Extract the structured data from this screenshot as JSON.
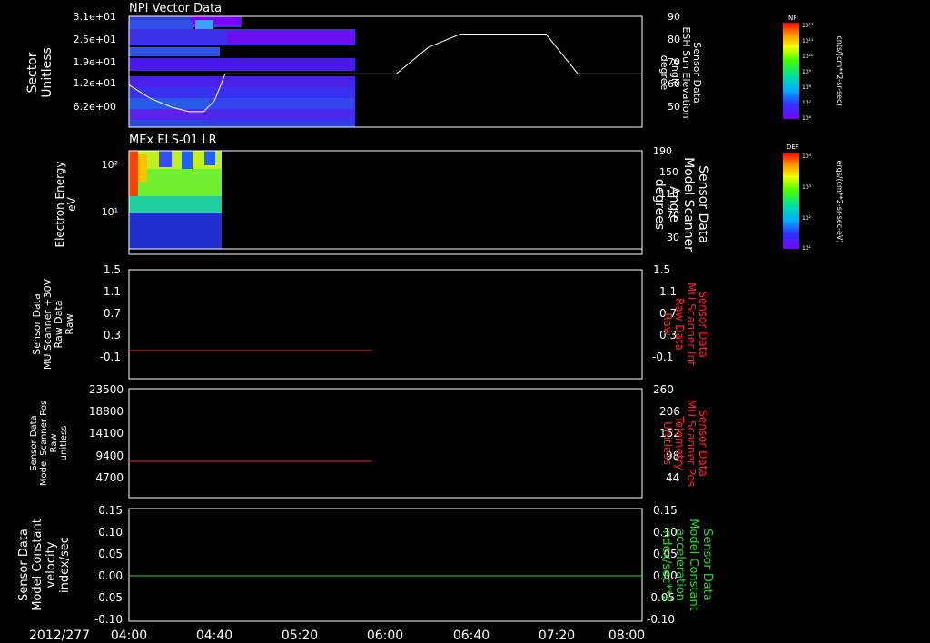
{
  "date_label": "2012/277",
  "time_axis": {
    "start": "04:00",
    "end": "08:00",
    "tick_labels": [
      "04:00",
      "04:40",
      "05:20",
      "06:00",
      "06:40",
      "07:20",
      "08:00"
    ]
  },
  "panels": [
    {
      "title": "NPI Vector Data",
      "left_label": [
        "Sector",
        "Unitless"
      ],
      "left_color": "#ffffff",
      "left_ticks": [
        "3.1e+01",
        "2.5e+01",
        "1.9e+01",
        "1.2e+01",
        "6.2e+00"
      ],
      "right_label": [
        "Sensor Data",
        "ESH Sun Elevation",
        "Angle",
        "degree"
      ],
      "right_color": "#ffffff",
      "right_ticks": [
        "90",
        "80",
        "70",
        "60",
        "50"
      ]
    },
    {
      "title": "MEx ELS-01 LR",
      "left_label": [
        "Electron Energy",
        "eV"
      ],
      "left_color": "#ffffff",
      "left_ticks": [
        "10²",
        "10¹"
      ],
      "right_label": [
        "Sensor Data",
        "Model Scanner",
        "Angle",
        "degrees"
      ],
      "right_color": "#ffffff",
      "right_ticks": [
        "190",
        "150",
        "110",
        "70",
        "30"
      ]
    },
    {
      "title": "",
      "left_label": [
        "Sensor Data",
        "MU Scanner +30V",
        "Raw Data",
        "Raw"
      ],
      "left_color": "#ffffff",
      "left_ticks": [
        "1.5",
        "1.1",
        "0.7",
        "0.3",
        "-0.1"
      ],
      "right_label": [
        "Sensor Data",
        "MU Scanner Int",
        "Raw Data",
        "Raw"
      ],
      "right_color": "#ff2020",
      "right_ticks": [
        "1.5",
        "1.1",
        "0.7",
        "0.3",
        "-0.1"
      ]
    },
    {
      "title": "",
      "left_label": [
        "Sensor Data",
        "Model Scanner Pos",
        "Raw",
        "unitless"
      ],
      "left_color": "#ffffff",
      "left_ticks": [
        "23500",
        "18800",
        "14100",
        "9400",
        "4700"
      ],
      "right_label": [
        "Sensor Data",
        "MU Scanner Pos",
        "Telemetry",
        "Unitless"
      ],
      "right_color": "#ff2020",
      "right_ticks": [
        "260",
        "206",
        "152",
        "98",
        "44"
      ]
    },
    {
      "title": "",
      "left_label": [
        "Sensor Data",
        "Model Constant",
        "velocity",
        "index/sec"
      ],
      "left_color": "#ffffff",
      "left_ticks": [
        "0.15",
        "0.10",
        "0.05",
        "0.00",
        "-0.05",
        "-0.10"
      ],
      "right_label": [
        "Sensor Data",
        "Model Constant",
        "acceleration",
        "index/sec**2"
      ],
      "right_color": "#22dd22",
      "right_ticks": [
        "0.15",
        "0.10",
        "0.05",
        "0.00",
        "-0.05",
        "-0.10"
      ]
    }
  ],
  "colorbars": [
    {
      "tag": "NF",
      "unit": "cnts/(cm**2-sr-sec)",
      "ticks": [
        "10¹²",
        "10¹¹",
        "10¹⁰",
        "10⁹",
        "10⁸",
        "10⁷",
        "10⁶"
      ]
    },
    {
      "tag": "DEF",
      "unit": "ergs/(cm**2-sr-sec-eV)",
      "ticks": [
        "10⁴",
        "10³",
        "10²",
        "10¹"
      ]
    }
  ],
  "chart_data": [
    {
      "type": "heatmap",
      "title": "NPI Vector Data",
      "ylabel": "Sector Unitless",
      "ylim": [
        0,
        34
      ],
      "x_range": [
        "04:00",
        "05:53"
      ],
      "yticks": [
        31,
        25,
        19,
        12,
        6.2
      ]
    },
    {
      "type": "line",
      "series": [
        {
          "name": "Sensor Data ESH Sun Elevation Angle",
          "x": [
            "04:00",
            "04:10",
            "04:20",
            "04:28",
            "04:35",
            "04:40",
            "04:45",
            "06:05",
            "06:20",
            "06:35",
            "07:15",
            "07:30",
            "08:00"
          ],
          "y": [
            59,
            53,
            49,
            47,
            47,
            52,
            64,
            64,
            76,
            82,
            82,
            64,
            64
          ]
        }
      ],
      "ylabel": "degree",
      "ylim": [
        40,
        90
      ]
    },
    {
      "type": "heatmap",
      "title": "MEx ELS-01 LR",
      "ylabel": "Electron Energy eV",
      "scale": "log",
      "x_range": [
        "04:00",
        "04:37"
      ]
    },
    {
      "type": "line",
      "series": [
        {
          "name": "Sensor Data Model Scanner Angle",
          "x": [
            "04:00",
            "08:00"
          ],
          "y": [
            10,
            10
          ]
        }
      ],
      "ylabel": "degrees",
      "ylim": [
        0,
        190
      ]
    },
    {
      "type": "line",
      "series": [
        {
          "name": "Sensor Data MU Scanner +30V Raw Data",
          "x": [
            "04:00",
            "05:55"
          ],
          "y": [
            0.0,
            0.0
          ],
          "color": "#ff2020"
        }
      ],
      "ylabel": "Raw",
      "ylim": [
        -0.3,
        1.5
      ]
    },
    {
      "type": "line",
      "series": [
        {
          "name": "Sensor Data Model Scanner Pos Raw",
          "x": [
            "04:00",
            "05:55"
          ],
          "y": [
            8200,
            8200
          ],
          "color": "#ff2020"
        }
      ],
      "ylabel": "unitless",
      "ylim": [
        0,
        23500
      ]
    },
    {
      "type": "line",
      "series": [
        {
          "name": "Sensor Data Model Constant velocity",
          "x": [
            "04:00",
            "08:00"
          ],
          "y": [
            0.0,
            0.0
          ],
          "color": "#22dd22"
        }
      ],
      "ylabel": "index/sec",
      "ylim": [
        -0.1,
        0.15
      ]
    }
  ]
}
